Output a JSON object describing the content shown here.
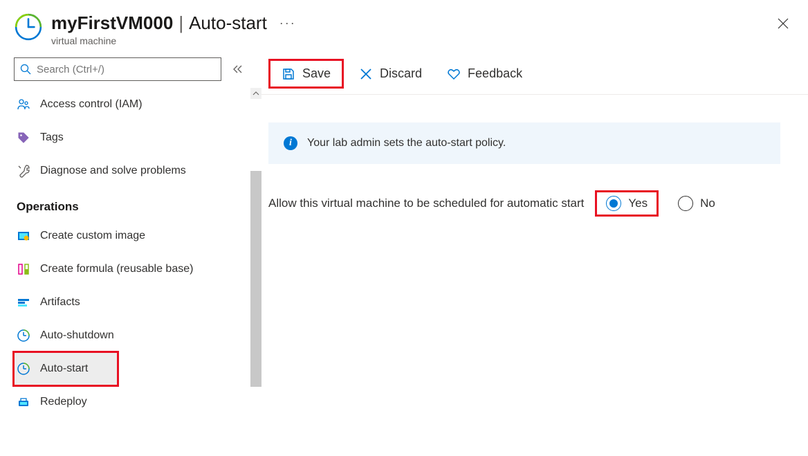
{
  "header": {
    "resource_name": "myFirstVM000",
    "page_name": "Auto-start",
    "resource_type": "virtual machine"
  },
  "sidebar": {
    "search_placeholder": "Search (Ctrl+/)",
    "items": {
      "access_control": "Access control (IAM)",
      "tags": "Tags",
      "diagnose": "Diagnose and solve problems"
    },
    "group_operations": "Operations",
    "operations": {
      "create_custom_image": "Create custom image",
      "create_formula": "Create formula (reusable base)",
      "artifacts": "Artifacts",
      "auto_shutdown": "Auto-shutdown",
      "auto_start": "Auto-start",
      "redeploy": "Redeploy"
    }
  },
  "toolbar": {
    "save": "Save",
    "discard": "Discard",
    "feedback": "Feedback"
  },
  "info": {
    "message": "Your lab admin sets the auto-start policy."
  },
  "setting": {
    "label": "Allow this virtual machine to be scheduled for automatic start",
    "option_yes": "Yes",
    "option_no": "No",
    "selected": "Yes"
  }
}
